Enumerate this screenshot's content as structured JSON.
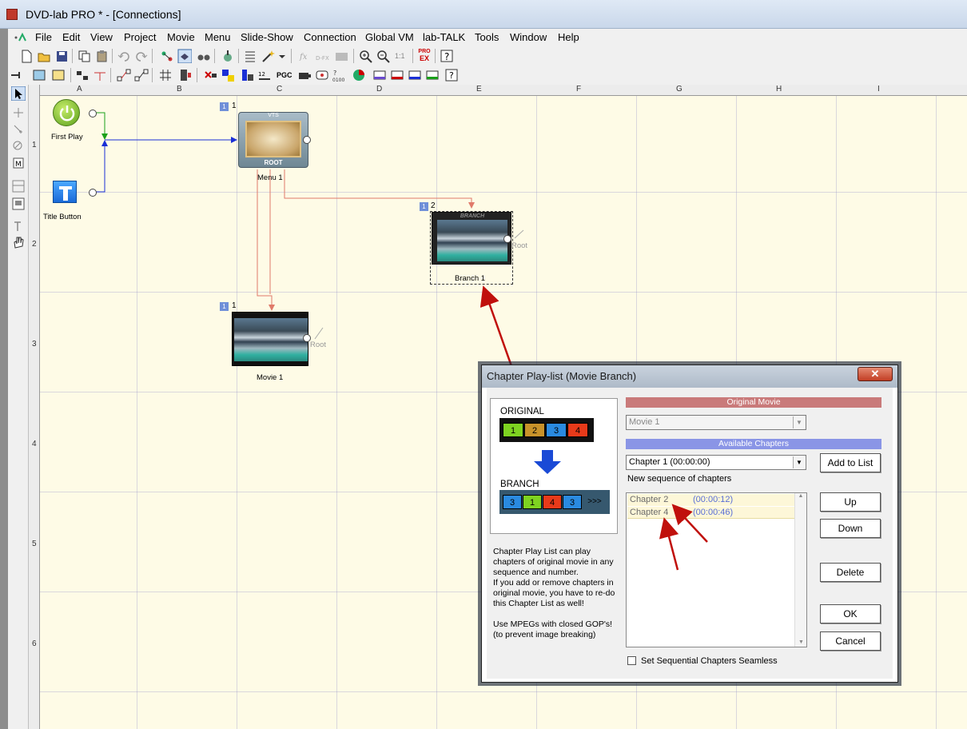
{
  "window": {
    "title": "DVD-lab PRO * - [Connections]"
  },
  "menu": [
    "File",
    "Edit",
    "View",
    "Project",
    "Movie",
    "Menu",
    "Slide-Show",
    "Connection",
    "Global VM",
    "lab-TALK",
    "Tools",
    "Window",
    "Help"
  ],
  "toolbar": {
    "pgc_label": "PGC",
    "zoom_label": "1:1",
    "pro_label": "PRO",
    "ex_label": "EX"
  },
  "rulers": {
    "columns": [
      "A",
      "B",
      "C",
      "D",
      "E",
      "F",
      "G",
      "H",
      "I"
    ],
    "rows": [
      "1",
      "2",
      "3",
      "4",
      "5",
      "6"
    ]
  },
  "nodes": {
    "first_play": {
      "label": "First Play"
    },
    "title_button": {
      "label": "Title Button"
    },
    "menu1": {
      "label": "Menu 1",
      "num": "1",
      "badge": "1",
      "top_tag": "VTS",
      "bottom_tag": "ROOT"
    },
    "branch1": {
      "label": "Branch 1",
      "num": "2",
      "badge": "1",
      "tag": "BRANCH",
      "root": "Root"
    },
    "movie1": {
      "label": "Movie 1",
      "num": "1",
      "badge": "1",
      "root": "Root"
    }
  },
  "dialog": {
    "title": "Chapter Play-list (Movie Branch)",
    "close": "✕",
    "diagram": {
      "original_label": "ORIGINAL",
      "original_cells": [
        "1",
        "2",
        "3",
        "4"
      ],
      "branch_label": "BRANCH",
      "branch_cells": [
        "3",
        "1",
        "4",
        "3",
        ">>>"
      ]
    },
    "info_text": "Chapter Play List can play\nchapters of original movie in any\nsequence and number.\nIf you add or remove chapters in\noriginal movie, you have to re-do\nthis Chapter List as well!\n\nUse MPEGs with closed GOP's!\n    (to prevent image breaking)",
    "original_movie_header": "Original Movie",
    "movie_select": "Movie 1",
    "available_chapters_header": "Available Chapters",
    "chapter_select": "Chapter 1 (00:00:00)",
    "add_to_list": "Add to List",
    "sequence_label": "New sequence of chapters",
    "sequence": [
      {
        "name": "Chapter 2",
        "time": "(00:00:12)"
      },
      {
        "name": "Chapter 4",
        "time": "(00:00:46)"
      }
    ],
    "up": "Up",
    "down": "Down",
    "delete": "Delete",
    "ok": "OK",
    "cancel": "Cancel",
    "seamless_label": "Set Sequential Chapters Seamless"
  },
  "colors": {
    "canvas_bg": "#fefbe6",
    "link_blue": "#1a2fd6",
    "link_green": "#1aa01a",
    "link_red": "#e07a6a",
    "arrow_dark_red": "#c0100c",
    "header_red": "#c97a7a",
    "header_blue": "#8a95e6"
  }
}
